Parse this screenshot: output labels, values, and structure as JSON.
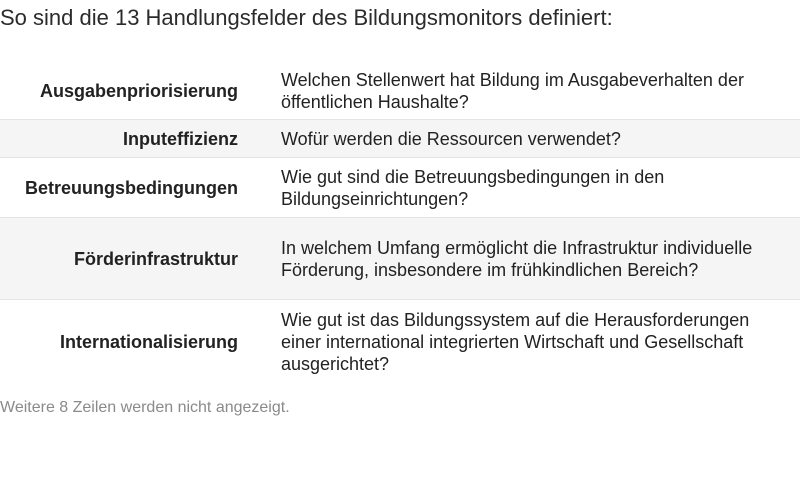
{
  "title": "So sind die 13 Handlungsfelder des Bildungsmonitors definiert:",
  "rows": [
    {
      "term": "Ausgabenpriorisierung",
      "description": "Welchen Stellenwert hat Bildung im Ausgabeverhalten der öffentlichen Haushalte?"
    },
    {
      "term": "Inputeffizienz",
      "description": "Wofür werden die Ressourcen verwendet?"
    },
    {
      "term": "Betreuungsbedingungen",
      "description": "Wie gut sind die Betreuungsbedingungen in den Bildungseinrichtungen?"
    },
    {
      "term": "Förderinfrastruktur",
      "description": "In welchem Umfang ermöglicht die Infrastruktur individuelle Förderung, insbesondere im frühkindlichen Bereich?"
    },
    {
      "term": "Internationalisierung",
      "description": "Wie gut ist das Bildungssystem auf die Herausforderungen einer international integrierten Wirtschaft und Gesellschaft ausgerichtet?"
    }
  ],
  "footnote": "Weitere 8 Zeilen werden nicht angezeigt."
}
